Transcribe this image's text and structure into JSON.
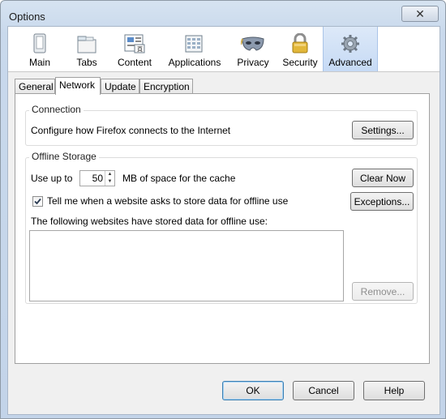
{
  "window": {
    "title": "Options",
    "close_glyph": "✕"
  },
  "toolbar": {
    "panes": [
      {
        "label": "Main",
        "icon": "main-icon"
      },
      {
        "label": "Tabs",
        "icon": "tabs-icon"
      },
      {
        "label": "Content",
        "icon": "content-icon"
      },
      {
        "label": "Applications",
        "icon": "applications-icon"
      },
      {
        "label": "Privacy",
        "icon": "privacy-mask-icon"
      },
      {
        "label": "Security",
        "icon": "padlock-icon"
      },
      {
        "label": "Advanced",
        "icon": "gear-icon",
        "selected": true
      }
    ]
  },
  "tabs": [
    {
      "label": "General"
    },
    {
      "label": "Network",
      "active": true
    },
    {
      "label": "Update"
    },
    {
      "label": "Encryption"
    }
  ],
  "connection": {
    "legend": "Connection",
    "description": "Configure how Firefox connects to the Internet",
    "settings_button": "Settings..."
  },
  "offline": {
    "legend": "Offline Storage",
    "use_up_to_label": "Use up to",
    "cache_value": "50",
    "cache_suffix": "MB of space for the cache",
    "clear_now_button": "Clear Now",
    "tell_me_label": "Tell me when a website asks to store data for offline use",
    "tell_me_checked": true,
    "exceptions_button": "Exceptions...",
    "websites_label": "The following websites have stored data for offline use:",
    "websites": [],
    "remove_button": "Remove..."
  },
  "footer": {
    "ok": "OK",
    "cancel": "Cancel",
    "help": "Help"
  },
  "colors": {
    "selected_pane": "#c6daf5",
    "frame": "#c3d4e9"
  }
}
